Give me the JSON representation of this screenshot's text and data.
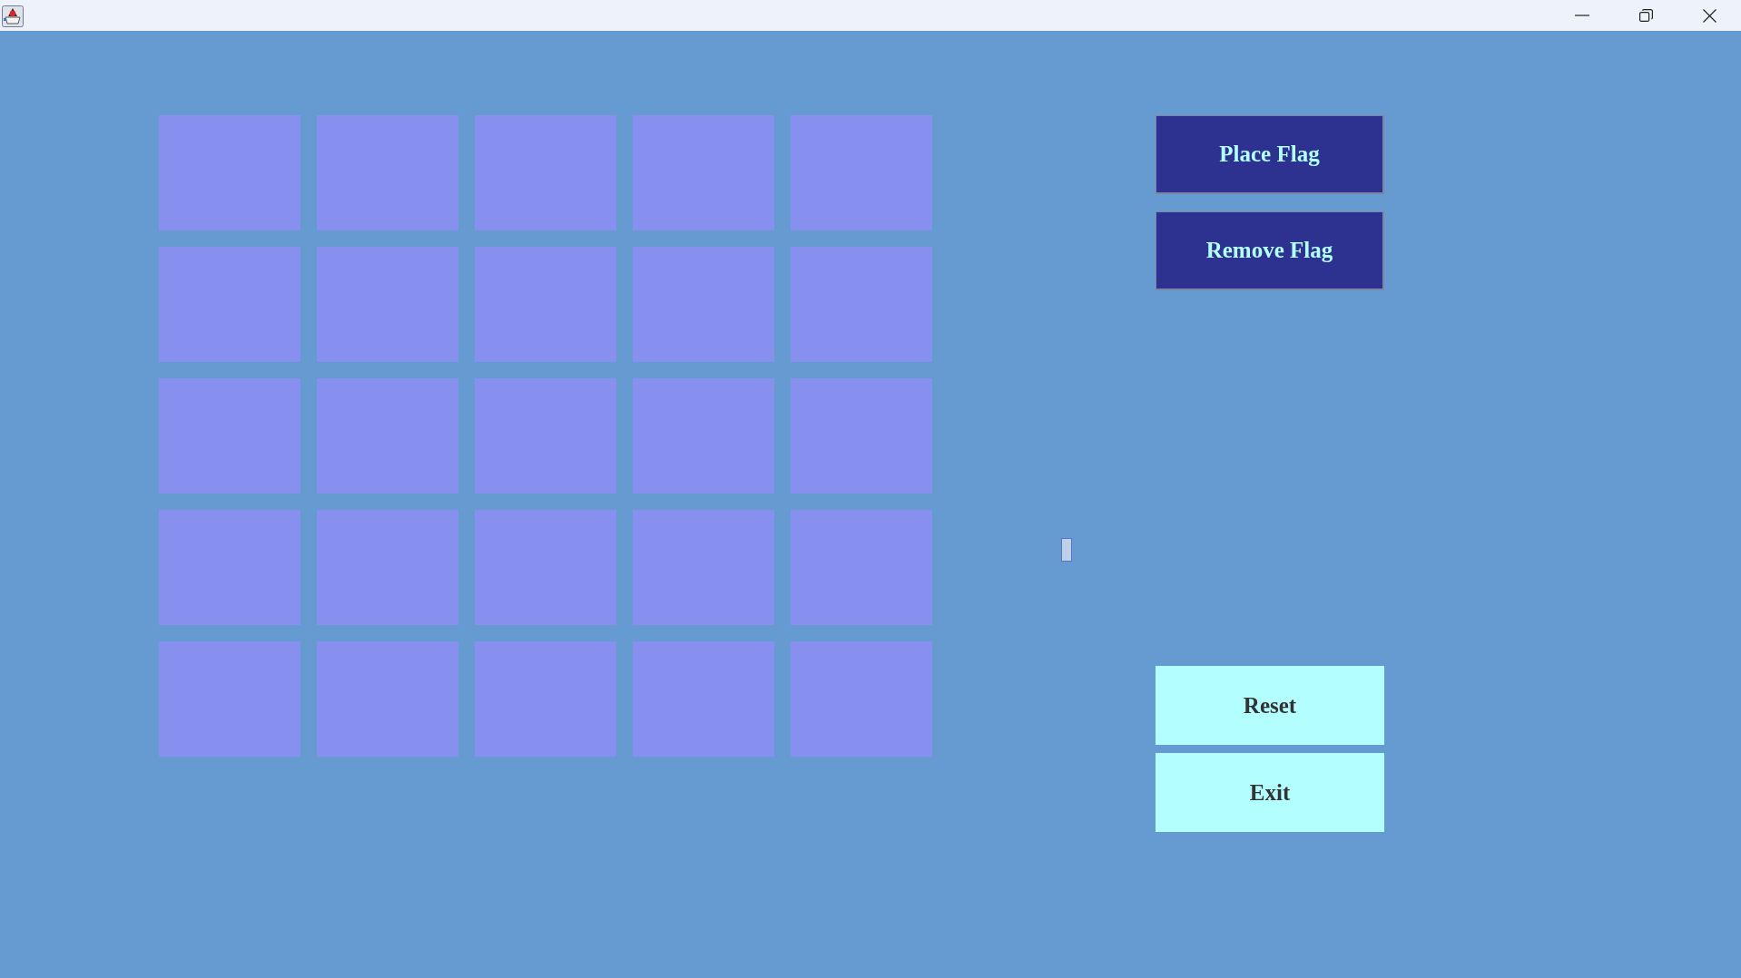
{
  "board": {
    "rows": [
      [
        {
          "flagged": false
        },
        {
          "flagged": false
        },
        {
          "flagged": false
        },
        {
          "flagged": false
        },
        {
          "flagged": false
        }
      ],
      [
        {
          "flagged": false
        },
        {
          "flagged": false
        },
        {
          "flagged": false
        },
        {
          "flagged": false
        },
        {
          "flagged": false
        }
      ],
      [
        {
          "flagged": false
        },
        {
          "flagged": false
        },
        {
          "flagged": false
        },
        {
          "flagged": false
        },
        {
          "flagged": false
        }
      ],
      [
        {
          "flagged": false
        },
        {
          "flagged": false
        },
        {
          "flagged": false
        },
        {
          "flagged": false
        },
        {
          "flagged": false
        }
      ],
      [
        {
          "flagged": false
        },
        {
          "flagged": false
        },
        {
          "flagged": false
        },
        {
          "flagged": false
        },
        {
          "flagged": false
        }
      ]
    ]
  },
  "flag_buttons": [
    "Place Flag",
    "Remove Flag"
  ],
  "game_buttons": [
    "Reset",
    "Exit"
  ]
}
